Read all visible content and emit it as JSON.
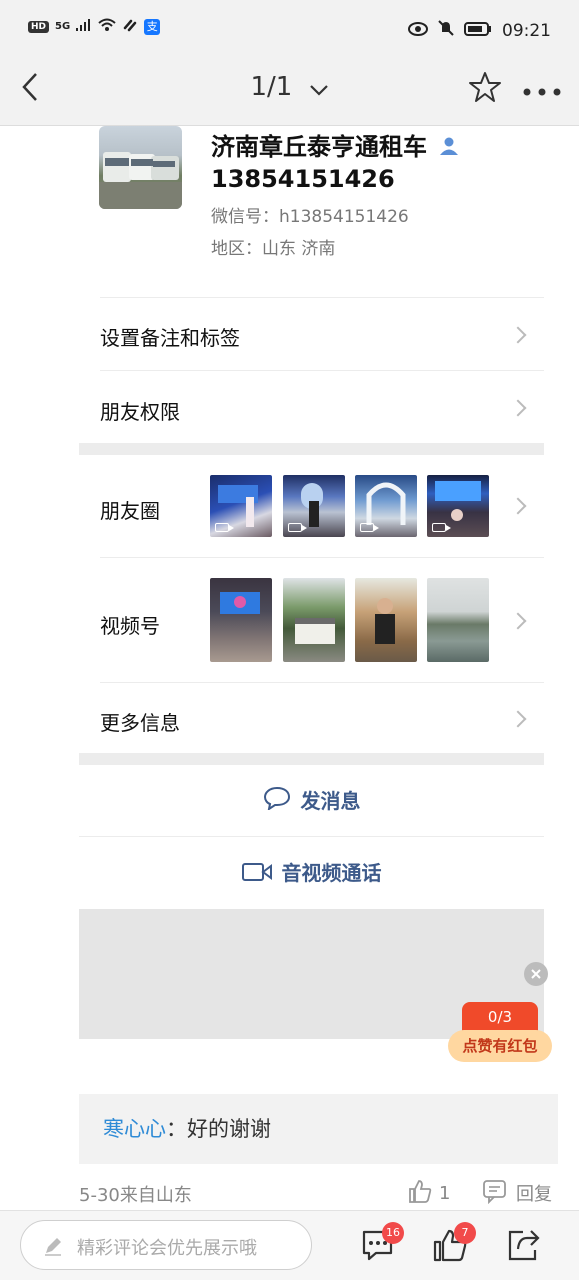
{
  "status_bar": {
    "hd": "HD",
    "network": "5G",
    "time": "09:21"
  },
  "nav": {
    "page_counter": "1/1"
  },
  "profile": {
    "name_line1": "济南章丘泰亨通租车",
    "name_line2": "13854151426",
    "wechat_id": "微信号：h13854151426",
    "region": "地区：山东 济南"
  },
  "rows": {
    "remark": "设置备注和标签",
    "permissions": "朋友权限",
    "moments": "朋友圈",
    "channels": "视频号",
    "more_info": "更多信息"
  },
  "actions": {
    "message": "发消息",
    "call": "音视频通话"
  },
  "promo": {
    "counter": "0/3",
    "label": "点赞有红包"
  },
  "comment": {
    "user": "寒心心",
    "separator": "：",
    "text": "好的谢谢",
    "meta": "5-30来自山东",
    "like_count": "1",
    "reply": "回复"
  },
  "bottom": {
    "placeholder": "精彩评论会优先展示哦",
    "comment_badge": "16",
    "like_badge": "7"
  },
  "colors": {
    "link_blue": "#3d5a8a",
    "username_blue": "#2f8bd6",
    "badge_red": "#f14a4a"
  }
}
